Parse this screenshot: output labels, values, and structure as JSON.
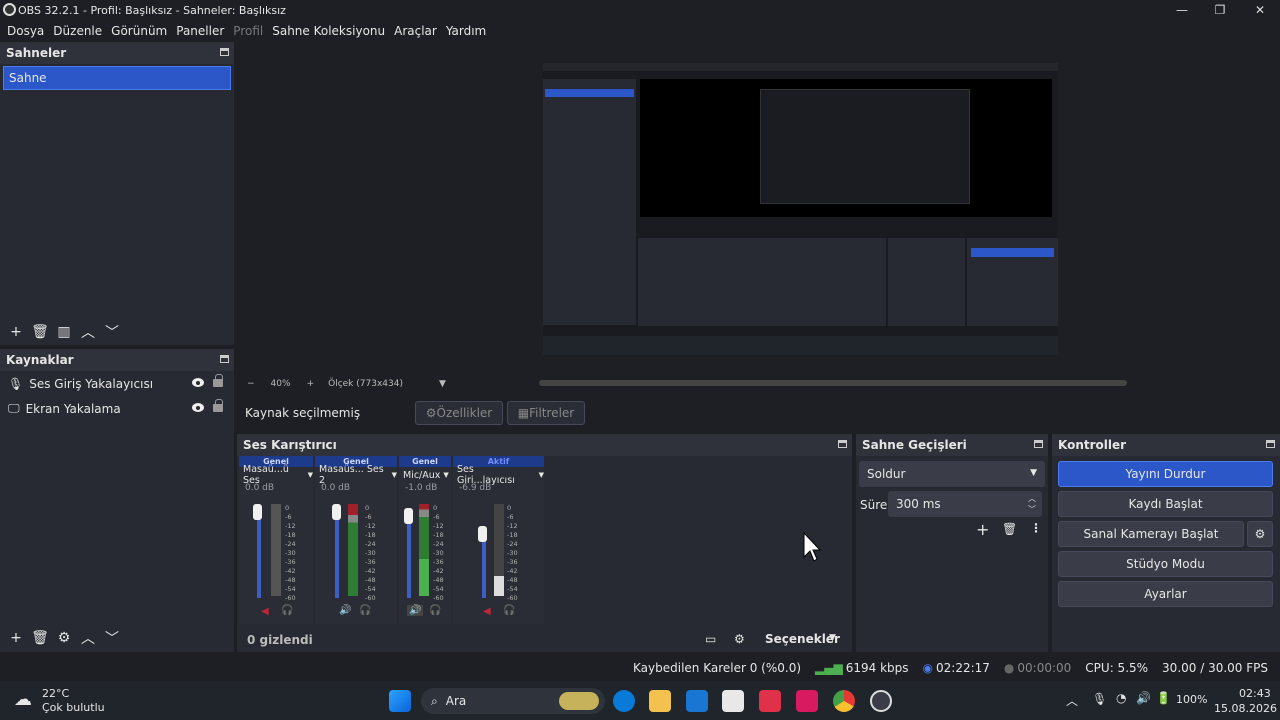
{
  "window": {
    "title": "OBS 32.2.1 - Profil: Başlıksız - Sahneler: Başlıksız"
  },
  "menu": [
    "Dosya",
    "Düzenle",
    "Görünüm",
    "Paneller",
    "Profil",
    "Sahne Koleksiyonu",
    "Araçlar",
    "Yardım"
  ],
  "scenes": {
    "title": "Sahneler",
    "items": [
      "Sahne"
    ]
  },
  "sources": {
    "title": "Kaynaklar",
    "items": [
      {
        "label": "Ses Giriş Yakalayıcısı",
        "icon": "microphone-icon"
      },
      {
        "label": "Ekran Yakalama",
        "icon": "monitor-icon"
      }
    ]
  },
  "preview_bar": {
    "zoom": "40%",
    "scale": "Ölçek (773x434)"
  },
  "source_bar": {
    "status": "Kaynak seçilmemiş",
    "properties": "Özellikler",
    "filters": "Filtreler"
  },
  "mixer": {
    "title": "Ses Karıştırıcı",
    "channels": [
      {
        "header": "Genel",
        "name": "Masaü...ü Ses",
        "db": "0.0 dB",
        "muted": true,
        "level": 0.0
      },
      {
        "header": "Genel",
        "name": "Masaüs... Ses 2",
        "db": "0.0 dB",
        "muted": false,
        "level": 0.6
      },
      {
        "header": "Genel",
        "name": "Mic/Aux",
        "db": "-1.0 dB",
        "muted": false,
        "level": 0.35
      },
      {
        "header": "Aktif",
        "name": "Ses Giri...layıcısı",
        "db": "-6.9 dB",
        "muted": true,
        "level": 0.0
      }
    ],
    "scale": [
      "0",
      "-6",
      "-12",
      "-18",
      "-24",
      "-30",
      "-36",
      "-42",
      "-48",
      "-54",
      "-60"
    ],
    "hidden": "0 gizlendi",
    "options": "Seçenekler"
  },
  "transitions": {
    "title": "Sahne Geçişleri",
    "type": "Soldur",
    "duration_label": "Süre",
    "duration": "300 ms"
  },
  "controls": {
    "title": "Kontroller",
    "stop_stream": "Yayını Durdur",
    "start_record": "Kaydı Başlat",
    "virtual_cam": "Sanal Kamerayı Başlat",
    "studio": "Stüdyo Modu",
    "settings": "Ayarlar"
  },
  "status": {
    "dropped": "Kaybedilen Kareler 0 (%0.0)",
    "bitrate": "6194 kbps",
    "stream_time": "02:22:17",
    "rec_time": "00:00:00",
    "cpu": "CPU: 5.5%",
    "fps": "30.00 / 30.00 FPS"
  },
  "taskbar": {
    "weather_temp": "22°C",
    "weather_desc": "Çok bulutlu",
    "search": "Ara",
    "battery": "100%",
    "time": "02:43",
    "date": "15.08.2026"
  },
  "colors": {
    "accent": "#2b57c9",
    "panel": "#272a33",
    "bg": "#1e1f24"
  }
}
